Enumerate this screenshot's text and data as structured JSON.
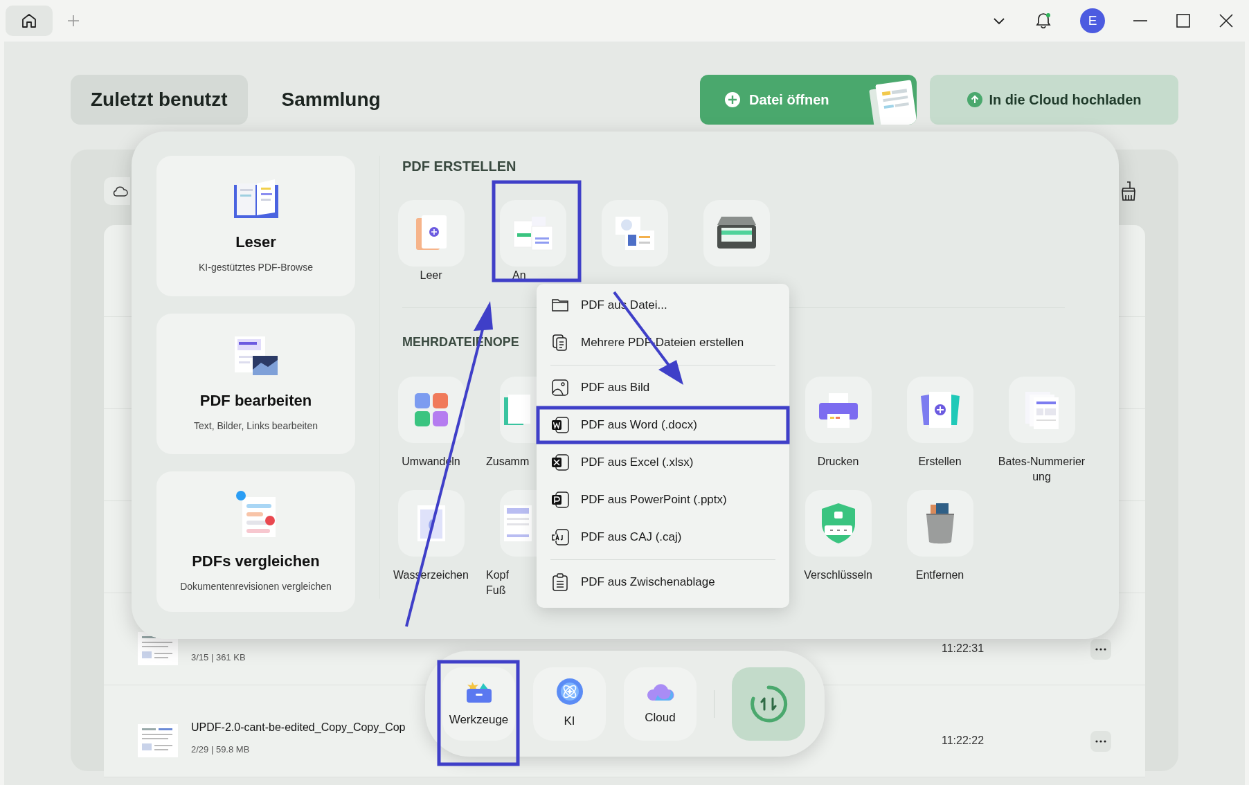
{
  "titlebar": {
    "avatar": "E",
    "notification": true
  },
  "tabs": [
    {
      "label": "Zuletzt benutzt",
      "selected": true
    },
    {
      "label": "Sammlung",
      "selected": false
    }
  ],
  "actions": [
    {
      "label": "Datei öffnen"
    },
    {
      "label": "In die Cloud hochladen"
    }
  ],
  "files": [
    {
      "meta": "3/15 | 361 KB",
      "time": "11:22:31"
    },
    {
      "name": "UPDF-2.0-cant-be-edited_Copy_Copy_Cop",
      "meta": "2/29 | 59.8 MB",
      "time": "11:22:22"
    }
  ],
  "tools_panel": {
    "cards": [
      {
        "title": "Leser",
        "subtitle": "KI-gestütztes PDF-Browse"
      },
      {
        "title": "PDF bearbeiten",
        "subtitle": "Text, Bilder, Links bearbeiten"
      },
      {
        "title": "PDFs vergleichen",
        "subtitle": "Dokumentenrevisionen vergleichen"
      }
    ],
    "create": {
      "heading": "PDF ERSTELLEN",
      "items": [
        {
          "kind": "tile",
          "label": "Leer"
        },
        {
          "kind": "tile",
          "label": "An"
        },
        {
          "kind": "tile"
        },
        {
          "kind": "tile"
        }
      ]
    },
    "batch": {
      "heading": "MEHRDATEIENOPE",
      "rows": [
        [
          {
            "label": "Umwandeln"
          },
          {
            "label": "Zusamm"
          },
          {
            "label": "Drucken"
          },
          {
            "label": "Erstellen"
          },
          {
            "label": "Bates-Nummerier\nung"
          }
        ],
        [
          {
            "label": "Wasserzeichen"
          },
          {
            "label": "Kopf\nFuß"
          },
          {
            "label": "Verschlüsseln"
          },
          {
            "label": "Entfernen"
          }
        ]
      ]
    }
  },
  "menu": {
    "groups": [
      [
        {
          "label": "PDF aus Datei..."
        },
        {
          "label": "Mehrere PDF-Dateien erstellen"
        }
      ],
      [
        {
          "label": "PDF aus Bild"
        },
        {
          "label": "PDF aus Word (.docx)"
        },
        {
          "label": "PDF aus Excel (.xlsx)"
        },
        {
          "label": "PDF aus PowerPoint (.pptx)"
        },
        {
          "label": "PDF aus CAJ (.caj)"
        }
      ],
      [
        {
          "label": "PDF aus Zwischenablage"
        }
      ]
    ]
  },
  "dock": {
    "items": [
      {
        "label": "Werkzeuge"
      },
      {
        "label": "KI"
      },
      {
        "label": "Cloud"
      }
    ]
  }
}
